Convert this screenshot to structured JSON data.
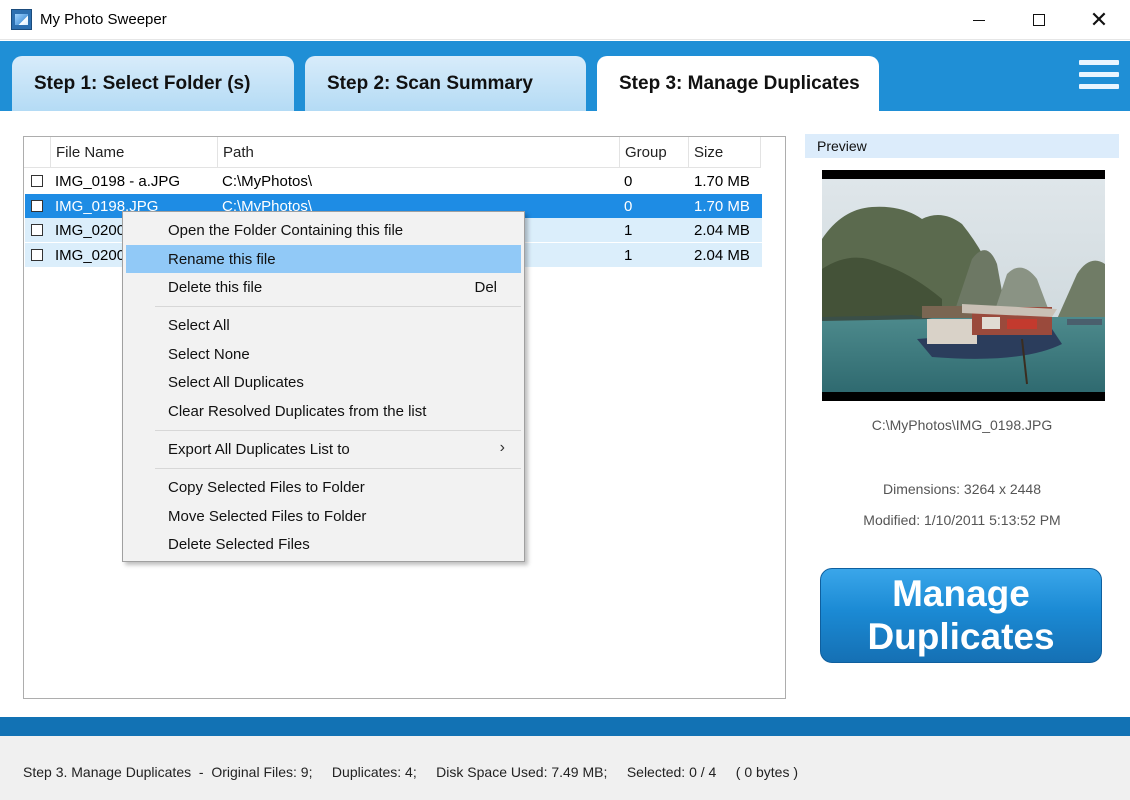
{
  "window": {
    "title": "My Photo Sweeper",
    "controls": {
      "minimize": "minimize",
      "maximize": "maximize",
      "close": "✕"
    }
  },
  "tabs": [
    {
      "label": "Step 1: Select Folder (s)",
      "active": false
    },
    {
      "label": "Step 2: Scan Summary",
      "active": false
    },
    {
      "label": "Step 3: Manage Duplicates",
      "active": true
    }
  ],
  "menu_icon": "hamburger-menu-icon",
  "file_list": {
    "columns": [
      "File Name",
      "Path",
      "Group",
      "Size"
    ],
    "rows": [
      {
        "name": "IMG_0198 - a.JPG",
        "path": "C:\\MyPhotos\\",
        "group": "0",
        "size": "1.70 MB",
        "checked": false,
        "state": "normal"
      },
      {
        "name": "IMG_0198.JPG",
        "path": "C:\\MyPhotos\\",
        "group": "0",
        "size": "1.70 MB",
        "checked": false,
        "state": "selected"
      },
      {
        "name": "IMG_0200",
        "path": "",
        "group": "1",
        "size": "2.04 MB",
        "checked": false,
        "state": "alt"
      },
      {
        "name": "IMG_0200",
        "path": "",
        "group": "1",
        "size": "2.04 MB",
        "checked": false,
        "state": "alt"
      }
    ]
  },
  "context_menu": {
    "items": [
      {
        "label": "Open the Folder Containing this file",
        "shortcut": ""
      },
      {
        "label": "Rename this file",
        "shortcut": "",
        "hover": true
      },
      {
        "label": "Delete this file",
        "shortcut": "Del"
      },
      {
        "label": "Select All",
        "shortcut": ""
      },
      {
        "label": "Select None",
        "shortcut": ""
      },
      {
        "label": "Select All Duplicates",
        "shortcut": ""
      },
      {
        "label": "Clear Resolved Duplicates from the list",
        "shortcut": ""
      },
      {
        "label": "Export All Duplicates List to",
        "shortcut": "",
        "submenu": true
      },
      {
        "label": "Copy Selected Files to Folder",
        "shortcut": ""
      },
      {
        "label": "Move Selected Files to Folder",
        "shortcut": ""
      },
      {
        "label": "Delete Selected Files",
        "shortcut": ""
      }
    ],
    "submenu_arrow": "›"
  },
  "preview": {
    "heading": "Preview",
    "file_path": "C:\\MyPhotos\\IMG_0198.JPG",
    "dimensions": "Dimensions: 3264 x 2448",
    "modified": "Modified: 1/10/2011 5:13:52 PM"
  },
  "manage_button": {
    "line1": "Manage",
    "line2": "Duplicates"
  },
  "status": {
    "text": "Step 3. Manage Duplicates  -  Original Files: 9;     Duplicates: 4;     Disk Space Used: 7.49 MB;     Selected: 0 / 4     ( 0 bytes )"
  },
  "colors": {
    "accent": "#1f8fd6",
    "status_band": "#1272b4",
    "selection": "#1e8ce4",
    "menu_hover": "#91c9f7"
  }
}
